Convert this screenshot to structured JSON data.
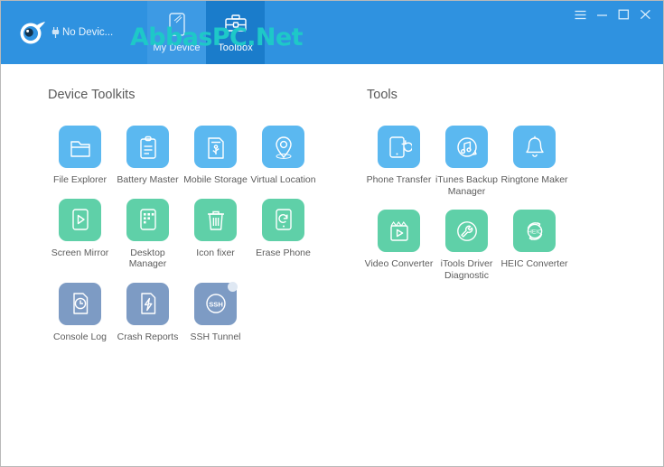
{
  "header": {
    "logo_name": "itools-comet-logo",
    "device_status": "No Devic...",
    "watermark": "AbbasPC.Net",
    "tabs": [
      {
        "label": "My Device",
        "icon": "device-icon",
        "active": false
      },
      {
        "label": "Toolbox",
        "icon": "toolbox-icon",
        "active": true
      }
    ],
    "window_controls": [
      {
        "name": "menu-button",
        "glyph": "≡"
      },
      {
        "name": "minimize-button",
        "glyph": "–"
      },
      {
        "name": "maximize-button",
        "glyph": "☐"
      },
      {
        "name": "close-button",
        "glyph": "✕"
      }
    ]
  },
  "colors": {
    "header": "#2f92e0",
    "tab_active": "#1a7ccb",
    "tab_inactive": "#3d9ae4",
    "tile_blue": "#5bb8f0",
    "tile_green": "#5fd0a8",
    "tile_slate": "#7d9bc4",
    "watermark": "#1ec8c8"
  },
  "sections": [
    {
      "title": "Device Toolkits",
      "items": [
        {
          "label": "File Explorer",
          "icon": "folder-icon",
          "color": "blue"
        },
        {
          "label": "Battery Master",
          "icon": "clipboard-icon",
          "color": "blue"
        },
        {
          "label": "Mobile Storage",
          "icon": "usb-card-icon",
          "color": "blue"
        },
        {
          "label": "Virtual Location",
          "icon": "map-pin-icon",
          "color": "blue"
        },
        {
          "label": "Screen Mirror",
          "icon": "play-screen-icon",
          "color": "green"
        },
        {
          "label": "Desktop Manager",
          "icon": "app-grid-icon",
          "color": "green"
        },
        {
          "label": "Icon fixer",
          "icon": "trash-icon",
          "color": "green"
        },
        {
          "label": "Erase Phone",
          "icon": "phone-refresh-icon",
          "color": "green"
        },
        {
          "label": "Console Log",
          "icon": "document-clock-icon",
          "color": "slate"
        },
        {
          "label": "Crash Reports",
          "icon": "document-bolt-icon",
          "color": "slate"
        },
        {
          "label": "SSH Tunnel",
          "icon": "ssh-circle-icon",
          "color": "slate",
          "badge": true
        }
      ]
    },
    {
      "title": "Tools",
      "items": [
        {
          "label": "Phone Transfer",
          "icon": "phone-transfer-icon",
          "color": "blue"
        },
        {
          "label": "iTunes Backup Manager",
          "icon": "music-refresh-icon",
          "color": "blue"
        },
        {
          "label": "Ringtone Maker",
          "icon": "bell-icon",
          "color": "blue"
        },
        {
          "label": "Video Converter",
          "icon": "clapperboard-icon",
          "color": "green"
        },
        {
          "label": "iTools Driver Diagnostic",
          "icon": "wrench-icon",
          "color": "green"
        },
        {
          "label": "HEIC Converter",
          "icon": "heic-convert-icon",
          "color": "green"
        }
      ]
    }
  ]
}
